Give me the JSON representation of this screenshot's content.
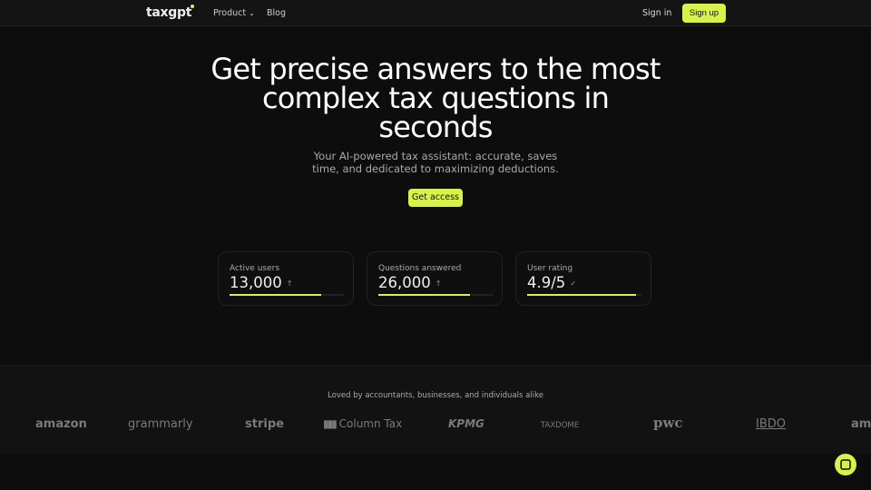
{
  "nav": {
    "logo": "taxgpt",
    "product": "Product",
    "blog": "Blog",
    "signin": "Sign in",
    "signup": "Sign up"
  },
  "hero": {
    "title": "Get precise answers to the most complex tax questions in seconds",
    "subtitle": "Your AI-powered tax assistant: accurate, saves time, and dedicated to maximizing deductions.",
    "cta": "Get access"
  },
  "stats": [
    {
      "label": "Active users",
      "value": "13,000",
      "icon": "arrow-up-icon",
      "glyph": "↑",
      "progress": 0.8
    },
    {
      "label": "Questions answered",
      "value": "26,000",
      "icon": "arrow-up-icon",
      "glyph": "↑",
      "progress": 0.8
    },
    {
      "label": "User rating",
      "value": "4.9/5",
      "icon": "check-icon",
      "glyph": "✓",
      "progress": 0.95
    }
  ],
  "logos": {
    "heading": "Loved by accountants, businesses, and individuals alike",
    "items": [
      "amazon",
      "grammarly",
      "stripe",
      "Column Tax",
      "KPMG",
      "TAXDOME",
      "pwc",
      "IBDO",
      "am"
    ]
  },
  "colors": {
    "accent": "#d9f24a",
    "background": "#0d0d0d"
  }
}
